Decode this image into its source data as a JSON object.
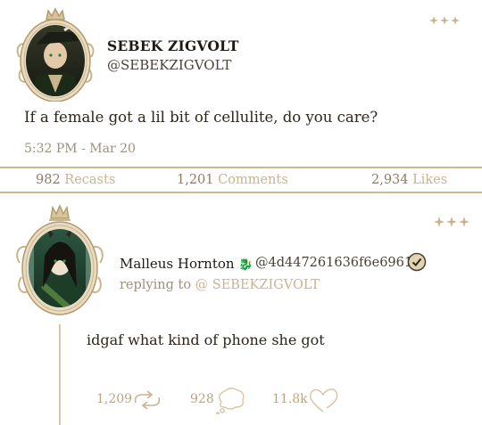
{
  "post": {
    "author_name": "SEBEK ZIGVOLT",
    "author_handle": "@SEBEKZIGVOLT",
    "text": "If a female got a lil bit of cellulite, do you care?",
    "timestamp": "5:32 PM - Mar 20",
    "more_icon": "three-stars-icon",
    "stats": {
      "recasts_count": "982",
      "recasts_label": "Recasts",
      "comments_count": "1,201",
      "comments_label": "Comments",
      "likes_count": "2,934",
      "likes_label": "Likes"
    }
  },
  "reply": {
    "author_name": "Malleus Hornton",
    "author_emoji": "🐉",
    "author_handle": "@4d447261636f6e6961",
    "verified_icon": "check-badge-icon",
    "replying_prefix": "replying to",
    "replying_handle": "@ SEBEKZIGVOLT",
    "text": "idgaf what kind of phone she got",
    "more_icon": "three-stars-icon",
    "actions": {
      "recast_count": "1,209",
      "comment_count": "928",
      "like_count": "11.8k"
    }
  },
  "colors": {
    "gold": "#c9b48e",
    "gold_dark": "#8f7d60",
    "text": "#2c261e",
    "muted": "#9b927f"
  }
}
